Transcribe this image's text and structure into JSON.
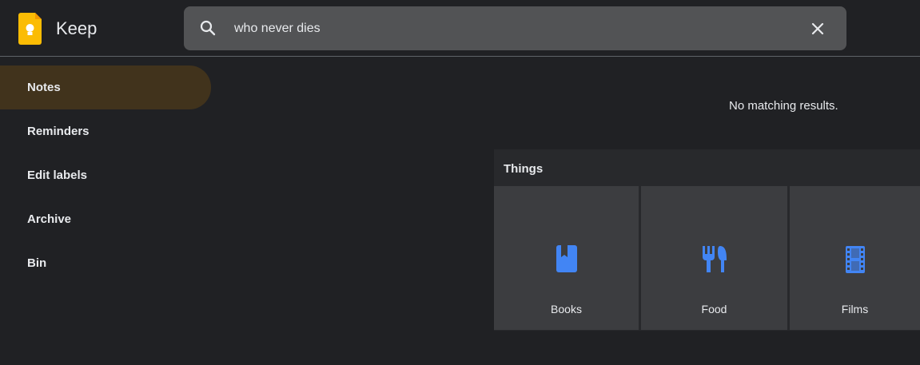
{
  "header": {
    "app_title": "Keep",
    "logo_icon": "keep-bulb-icon",
    "search": {
      "value": "who never dies",
      "icon": "search-icon",
      "clear_icon": "close-icon"
    }
  },
  "sidebar": {
    "items": [
      {
        "label": "Notes",
        "active": true
      },
      {
        "label": "Reminders",
        "active": false
      },
      {
        "label": "Edit labels",
        "active": false
      },
      {
        "label": "Archive",
        "active": false
      },
      {
        "label": "Bin",
        "active": false
      }
    ]
  },
  "main": {
    "no_results_text": "No matching results.",
    "things": {
      "title": "Things",
      "tiles": [
        {
          "label": "Books",
          "icon": "book-icon"
        },
        {
          "label": "Food",
          "icon": "utensils-icon"
        },
        {
          "label": "Films",
          "icon": "film-icon"
        }
      ]
    }
  },
  "colors": {
    "background": "#202124",
    "search_bg": "#525355",
    "active_nav": "#41331c",
    "tile_bg": "#3c3d40",
    "panel_bg": "#28292c",
    "accent_blue": "#4285f4",
    "logo_yellow": "#fbbc04"
  }
}
